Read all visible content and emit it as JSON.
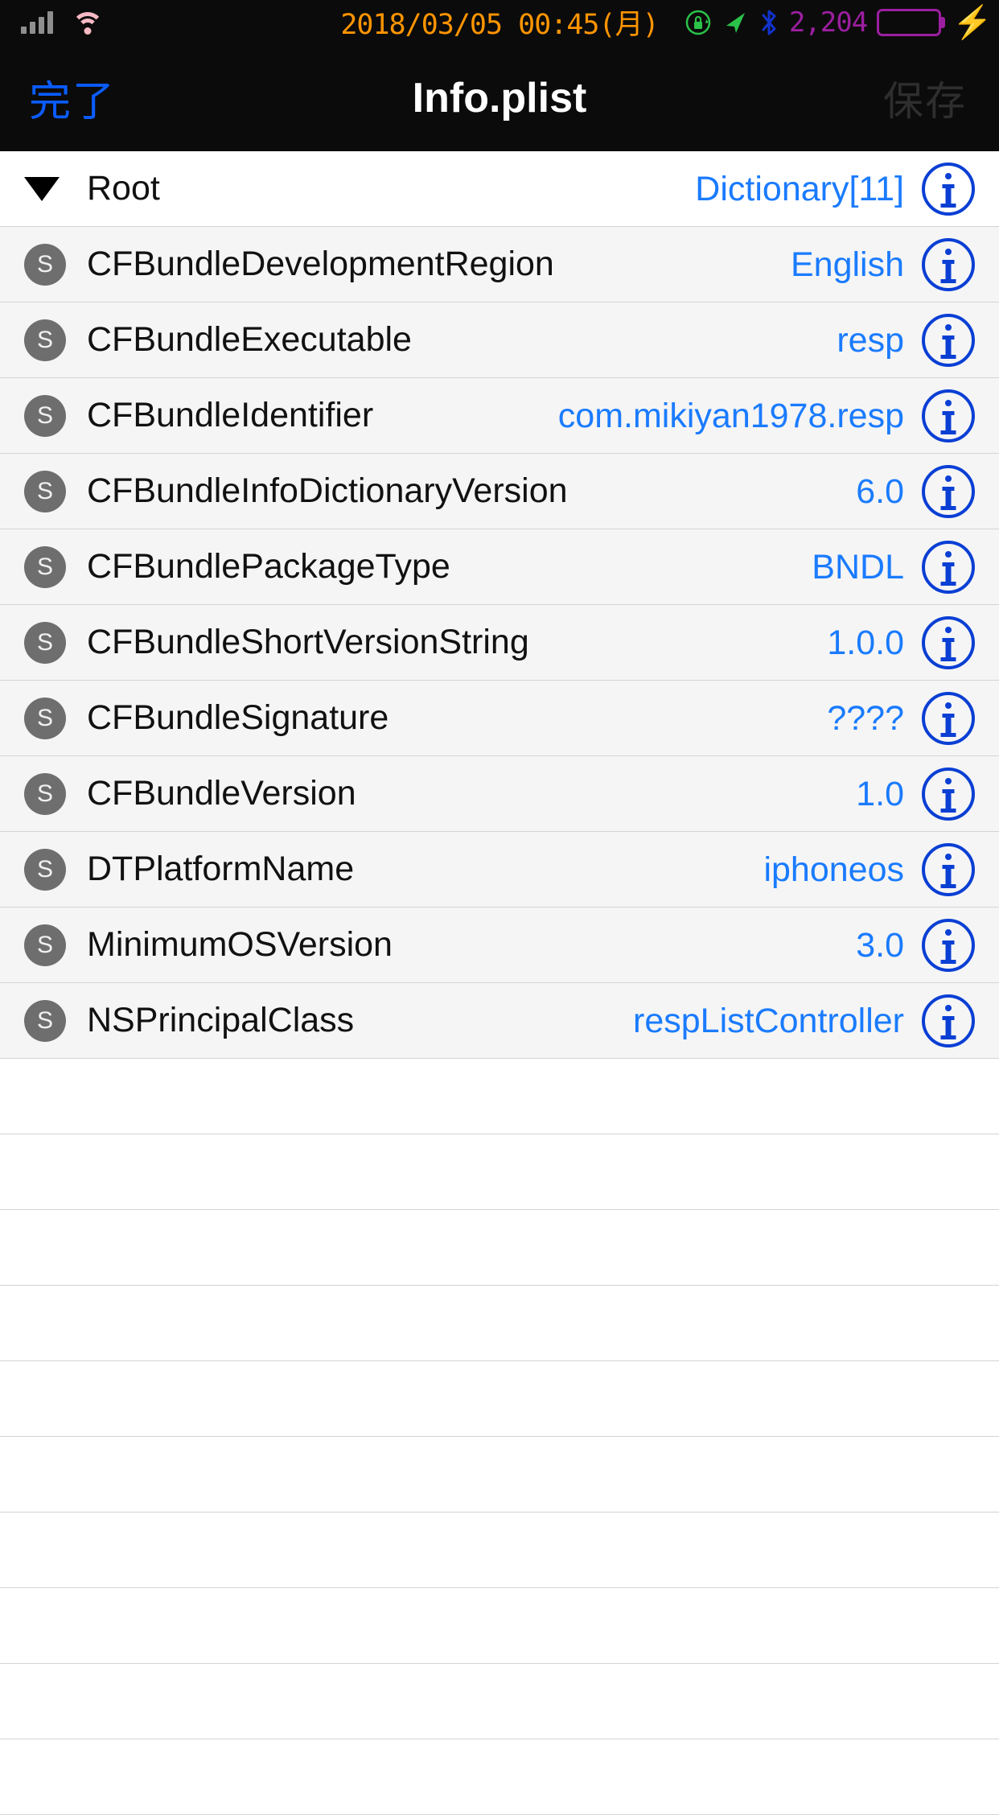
{
  "status_bar": {
    "signal_icon": "cellular-signal-icon",
    "signal_bars": 4,
    "wifi_icon": "wifi-icon",
    "datetime": "2018/03/05 00:45(月)",
    "rotation_lock_icon": "rotation-lock-icon",
    "location_icon": "location-arrow-icon",
    "bluetooth_icon": "bluetooth-icon",
    "counter": "2,204",
    "battery_icon": "battery-icon",
    "charging_icon": "charging-bolt-icon",
    "colors": {
      "datetime": "#FF9500",
      "wifi": "#F7B9C4",
      "signal": "#8E8E8E",
      "rotation_lock": "#2BC24A",
      "location": "#2BC24A",
      "bluetooth": "#1133CC",
      "counter": "#9B1FA0",
      "battery_fill": "#52E064",
      "battery_outline": "#9B1FA0",
      "bolt": "#9B1FA0"
    }
  },
  "nav_bar": {
    "done_label": "完了",
    "title": "Info.plist",
    "save_label": "保存",
    "done_color": "#0B5CFF",
    "save_color": "#2E2E2E",
    "title_color": "#FFFFFF",
    "background": "#0B0B0B"
  },
  "table": {
    "value_color": "#1A7BFF",
    "info_color": "#0A3FD4",
    "root_row": {
      "key": "Root",
      "value": "Dictionary[11]",
      "disclosure": "triangle-down-icon",
      "expanded": true,
      "info_icon": "info-icon"
    },
    "rows": [
      {
        "type_badge": "S",
        "key": "CFBundleDevelopmentRegion",
        "value": "English"
      },
      {
        "type_badge": "S",
        "key": "CFBundleExecutable",
        "value": "resp"
      },
      {
        "type_badge": "S",
        "key": "CFBundleIdentifier",
        "value": "com.mikiyan1978.resp"
      },
      {
        "type_badge": "S",
        "key": "CFBundleInfoDictionaryVersion",
        "value": "6.0"
      },
      {
        "type_badge": "S",
        "key": "CFBundlePackageType",
        "value": "BNDL"
      },
      {
        "type_badge": "S",
        "key": "CFBundleShortVersionString",
        "value": "1.0.0"
      },
      {
        "type_badge": "S",
        "key": "CFBundleSignature",
        "value": "????"
      },
      {
        "type_badge": "S",
        "key": "CFBundleVersion",
        "value": "1.0"
      },
      {
        "type_badge": "S",
        "key": "DTPlatformName",
        "value": "iphoneos"
      },
      {
        "type_badge": "S",
        "key": "MinimumOSVersion",
        "value": "3.0"
      },
      {
        "type_badge": "S",
        "key": "NSPrincipalClass",
        "value": "respListController"
      }
    ],
    "blank_rows": 4
  }
}
